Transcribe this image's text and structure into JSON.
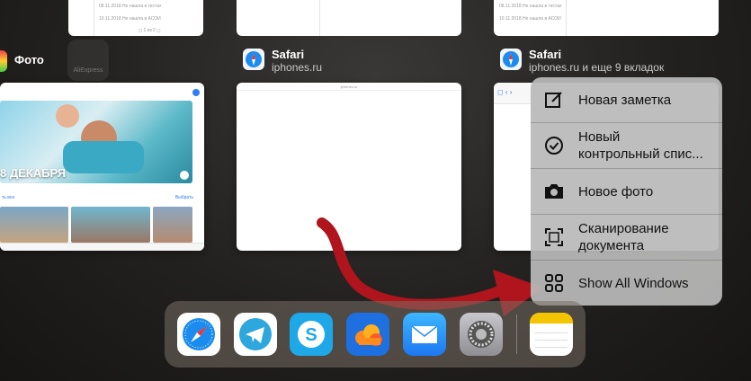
{
  "switcher": {
    "apps": [
      {
        "title": "Фото",
        "subtitle": ""
      },
      {
        "title": "Safari",
        "subtitle": "iphones.ru"
      },
      {
        "title": "Safari",
        "subtitle": "iphones.ru и еще 9 вкладок"
      }
    ],
    "photos_card": {
      "date_label": "8 ДЕКАБРЯ",
      "left_link": "ть все",
      "right_link": "Выбрать"
    },
    "safari_card": {
      "url": "iphones.ru"
    }
  },
  "context_menu": {
    "items": [
      {
        "label": "Новая заметка",
        "icon": "compose-icon"
      },
      {
        "label": "Новый контрольный спис...",
        "icon": "checkmark-circle-icon"
      },
      {
        "label": "Новое фото",
        "icon": "camera-icon"
      },
      {
        "label": "Сканирование документа",
        "icon": "scan-document-icon"
      },
      {
        "label": "Show All Windows",
        "icon": "grid-icon"
      }
    ]
  },
  "dock": {
    "apps": [
      "Safari",
      "Telegram",
      "Skype",
      "Cloud",
      "Mail",
      "Settings",
      "Notes"
    ]
  },
  "colors": {
    "arrow": "#b0141c",
    "menu_bg": "#b9b9b9",
    "safari_blue": "#1a8cf0"
  }
}
